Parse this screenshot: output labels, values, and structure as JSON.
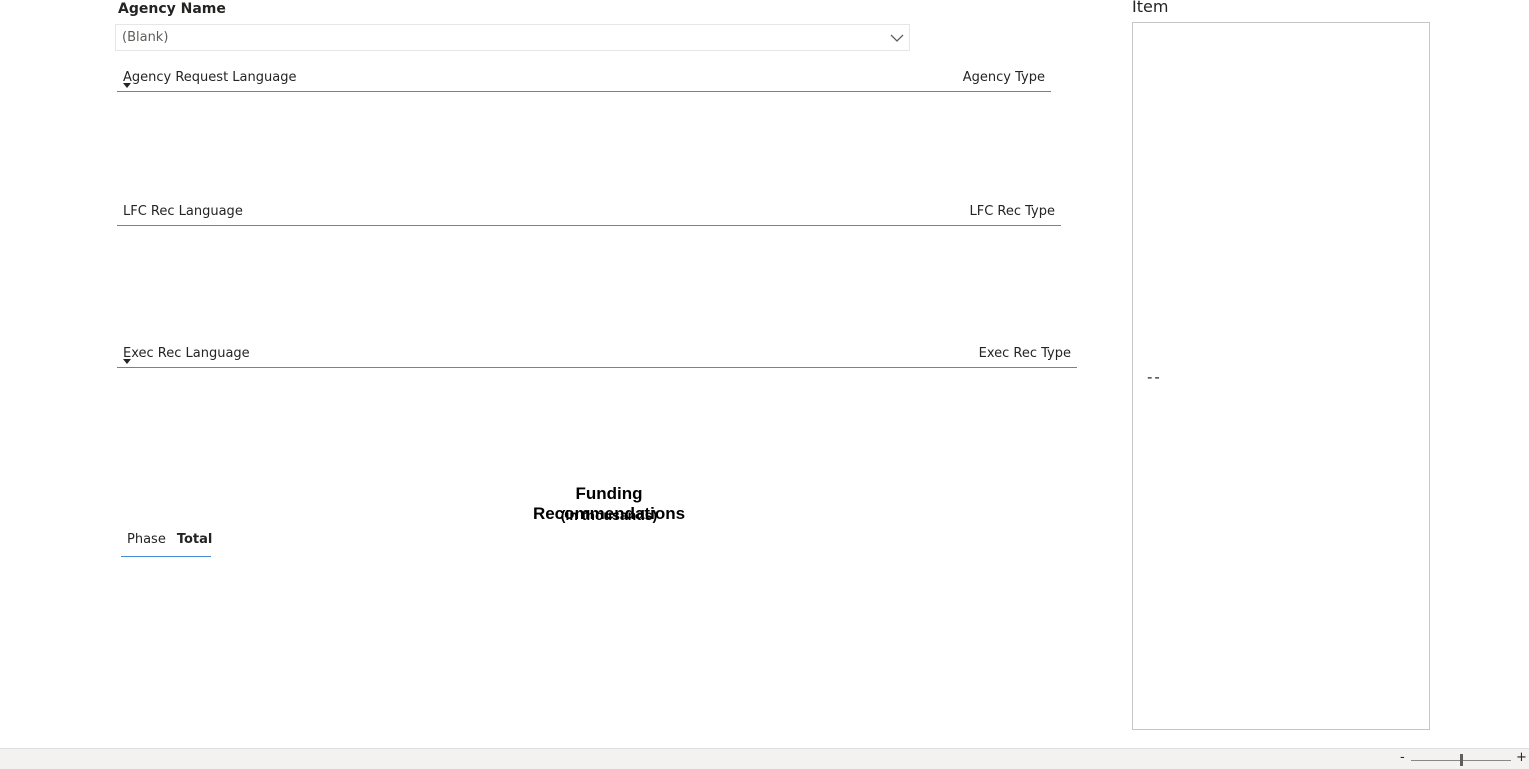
{
  "agency_slicer": {
    "title": "Agency Name",
    "selected_value": "(Blank)"
  },
  "agency_request_table": {
    "left_header": "Agency Request Language",
    "right_header": "Agency Type"
  },
  "lfc_table": {
    "left_header": "LFC Rec Language",
    "right_header": "LFC Rec Type"
  },
  "exec_table": {
    "left_header": "Exec Rec Language",
    "right_header": "Exec Rec Type"
  },
  "funding": {
    "title": "Funding Recommendations",
    "subtitle": "(in thousands)",
    "columns": [
      "Phase",
      "Total"
    ]
  },
  "item_card": {
    "title": "Item",
    "value": "--"
  },
  "zoom": {
    "minus": "-",
    "plus": "+"
  },
  "colors": {
    "accent_line": "#4a8bd6",
    "border": "#c8c6c4",
    "status_bar": "#f3f2f1"
  }
}
